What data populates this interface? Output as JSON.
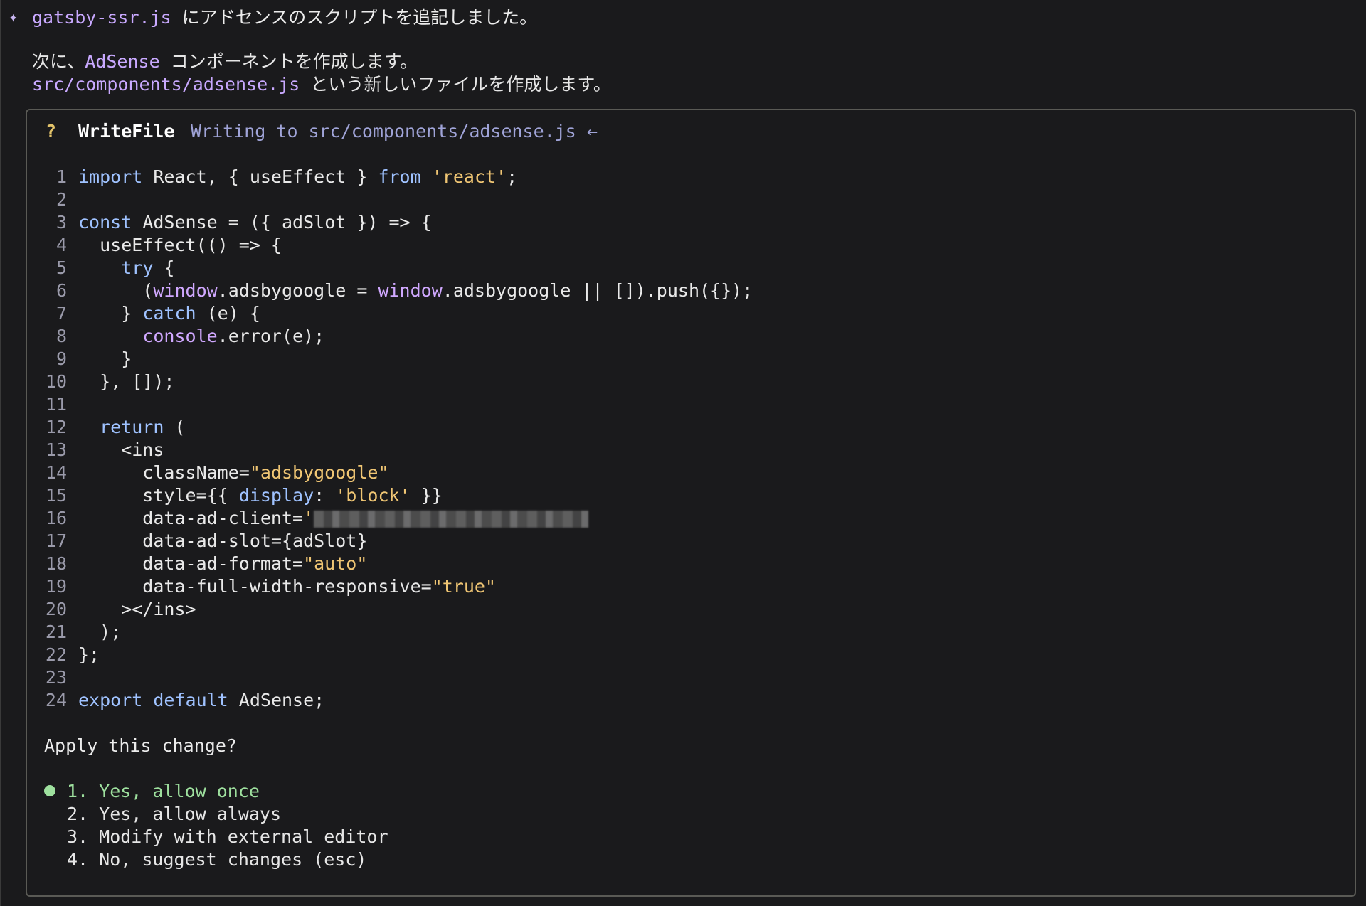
{
  "status": {
    "file": "gatsby-ssr.js",
    "message": " にアドセンスのスクリプトを追記しました。"
  },
  "next_step": {
    "line1_prefix": "次に、",
    "line1_name": "AdSense",
    "line1_suffix": " コンポーネントを作成します。",
    "line2_path": "src/components/adsense.js",
    "line2_suffix": " という新しいファイルを作成します。"
  },
  "dialog": {
    "question_mark": "?",
    "tool_name": "WriteFile",
    "tool_desc": "Writing to src/components/adsense.js ←",
    "code_lines": [
      {
        "n": "1"
      },
      {
        "n": "2"
      },
      {
        "n": "3"
      },
      {
        "n": "4"
      },
      {
        "n": "5"
      },
      {
        "n": "6"
      },
      {
        "n": "7"
      },
      {
        "n": "8"
      },
      {
        "n": "9"
      },
      {
        "n": "10"
      },
      {
        "n": "11"
      },
      {
        "n": "12"
      },
      {
        "n": "13"
      },
      {
        "n": "14"
      },
      {
        "n": "15"
      },
      {
        "n": "16"
      },
      {
        "n": "17"
      },
      {
        "n": "18"
      },
      {
        "n": "19"
      },
      {
        "n": "20"
      },
      {
        "n": "21"
      },
      {
        "n": "22"
      },
      {
        "n": "23"
      },
      {
        "n": "24"
      }
    ],
    "prompt": "Apply this change?",
    "options": [
      {
        "label": "1. Yes, allow once",
        "selected": true
      },
      {
        "label": "2. Yes, allow always",
        "selected": false
      },
      {
        "label": "3. Modify with external editor",
        "selected": false
      },
      {
        "label": "4. No, suggest changes (esc)",
        "selected": false
      }
    ]
  },
  "colors": {
    "background": "#1a1a1c",
    "accent_purple": "#c9a9ff",
    "keyword_blue": "#9fc2ff",
    "string_yellow": "#f0c674",
    "selected_green": "#9ee09e"
  }
}
